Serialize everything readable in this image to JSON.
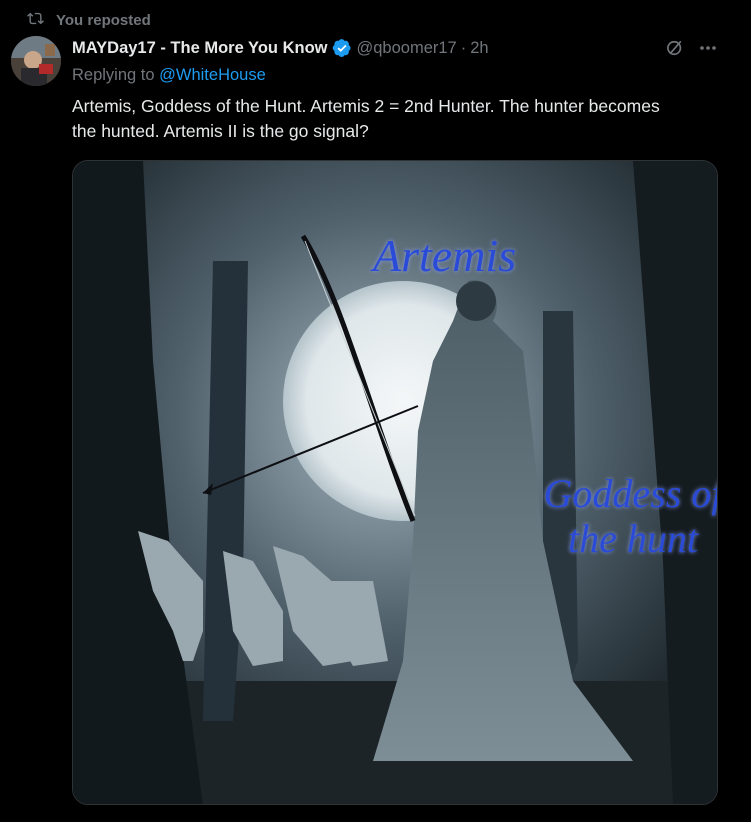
{
  "repost": {
    "label": "You reposted",
    "icon": "repost-icon"
  },
  "author": {
    "name": "MAYDay17 - The More You Know",
    "handle": "@qboomer17",
    "separator": "·",
    "time": "2h",
    "verified": true
  },
  "reply": {
    "prefix": "Replying to ",
    "mention": "@WhiteHouse"
  },
  "tweet": {
    "text": "Artemis, Goddess of the Hunt. Artemis 2 = 2nd Hunter. The hunter becomes the hunted. Artemis II is the go signal?"
  },
  "media": {
    "overlay_title": "Artemis",
    "overlay_subtitle": "Goddess of the hunt"
  },
  "colors": {
    "accent": "#1d9bf0",
    "muted": "#71767b",
    "text": "#e7e9ea",
    "background": "#000000"
  }
}
